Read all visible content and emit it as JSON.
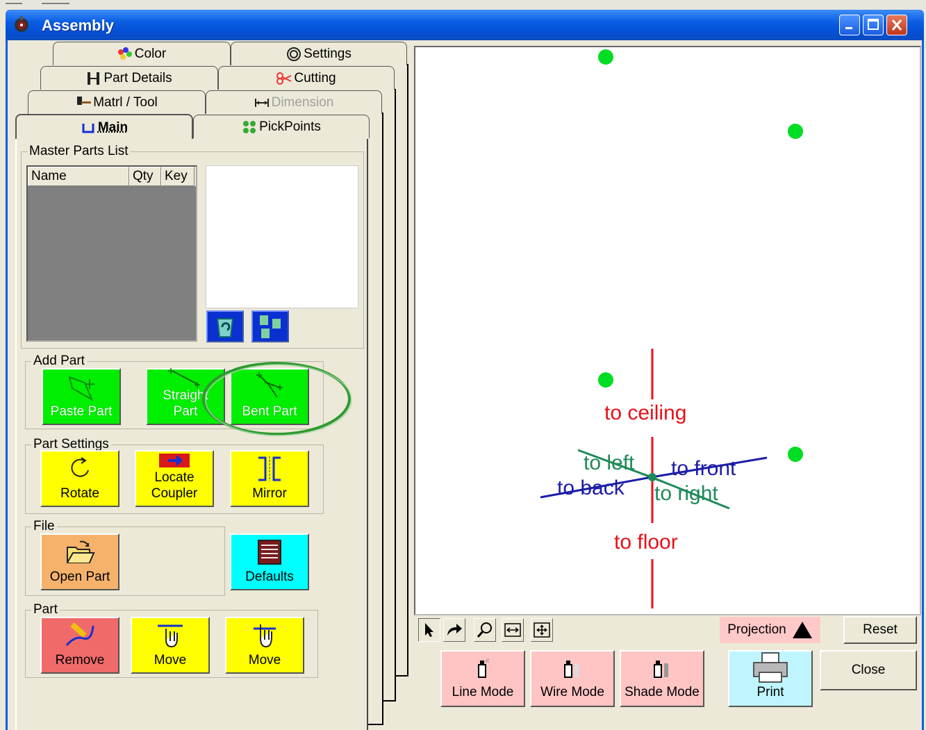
{
  "window": {
    "title": "Assembly",
    "minimize_label": "_",
    "maximize_label": "□",
    "close_label": "✕"
  },
  "tabs": {
    "color": "Color",
    "settings": "Settings",
    "part_details": "Part Details",
    "cutting": "Cutting",
    "matrl_tool": "Matrl / Tool",
    "dimension": "Dimension",
    "main": "Main",
    "pickpoints": "PickPoints"
  },
  "master_parts_list": {
    "legend": "Master Parts List",
    "columns": [
      "Name",
      "Qty",
      "Key"
    ]
  },
  "add_part": {
    "legend": "Add Part",
    "paste_part": "Paste Part",
    "straight_part_line1": "Straight",
    "straight_part_line2": "Part",
    "bent_part": "Bent Part"
  },
  "part_settings": {
    "legend": "Part Settings",
    "rotate": "Rotate",
    "locate_coupler_line1": "Locate",
    "locate_coupler_line2": "Coupler",
    "mirror": "Mirror"
  },
  "file": {
    "legend": "File",
    "open_part": "Open Part",
    "defaults": "Defaults"
  },
  "part": {
    "legend": "Part",
    "remove": "Remove",
    "move1": "Move",
    "move2": "Move"
  },
  "viewport": {
    "to_ceiling": "to ceiling",
    "to_floor": "to floor",
    "to_left": "to left",
    "to_right": "to right",
    "to_front": "to front",
    "to_back": "to back",
    "colors": {
      "vertical": "#e8101a",
      "left_right": "#1f8a5a",
      "front_back": "#1c1ca8",
      "pick": "#00dd22"
    }
  },
  "bottom": {
    "projection": "Projection",
    "reset": "Reset",
    "close": "Close",
    "line_mode": "Line Mode",
    "wire_mode": "Wire Mode",
    "shade_mode": "Shade Mode",
    "print": "Print"
  }
}
